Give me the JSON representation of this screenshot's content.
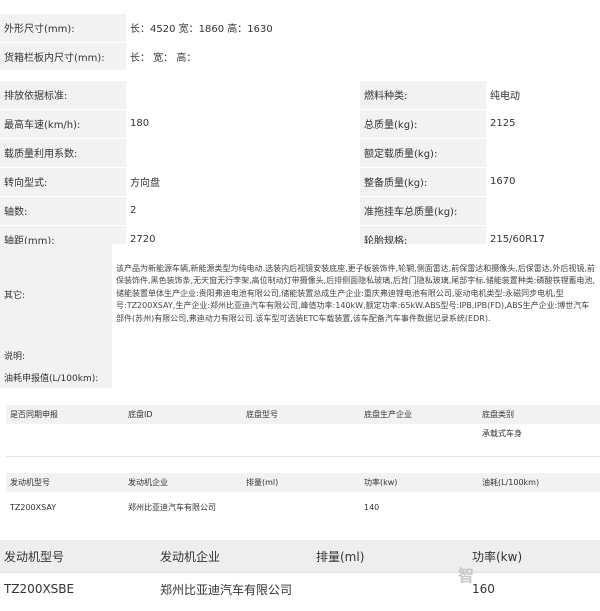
{
  "specs": {
    "dims_label": "外形尺寸(mm):",
    "dims_value": "长：4520 宽：1860 高：1630",
    "cargo_label": "货箱栏板内尺寸(mm):",
    "cargo_value": "长： 宽： 高：",
    "emission_label": "排放依据标准:",
    "fuel_label": "燃料种类:",
    "fuel_value": "纯电动",
    "speed_label": "最高车速(km/h):",
    "speed_value": "180",
    "total_mass_label": "总质量(kg):",
    "total_mass_value": "2125",
    "load_util_label": "载质量利用系数:",
    "rated_load_label": "额定载质量(kg):",
    "steering_label": "转向型式:",
    "steering_value": "方向盘",
    "curb_mass_label": "整备质量(kg):",
    "curb_mass_value": "1670",
    "axles_label": "轴数:",
    "axles_value": "2",
    "trailer_label": "准拖挂车总质量(kg):",
    "wheelbase_label": "轴距(mm):",
    "wheelbase_value": "2720",
    "tire_label": "轮胎规格:",
    "tire_value": "215/60R17"
  },
  "other": {
    "label": "其它:",
    "text": "该产品为新能源车辆,新能源类型为纯电动.选装内后视镜安装底座,更子板装饰件,轮辋,侧面雷达,前保雷达和摄像头,后保雷达,外后视镜,前保装饰件,黑色装饰条,无天窗无行李架,高位制动灯带摄像头,后排侧面隐私玻璃,后背门隐私玻璃,尾部字标.储能装置种类:磷酸铁锂蓄电池,储能装置单体生产企业:贵阳弗迪电池有限公司,储能装置总成生产企业:重庆弗迪锂电池有限公司,驱动电机类型:永磁同步电机,型号:TZ200XSAY,生产企业:郑州比亚迪汽车有限公司,峰值功率:140kW,额定功率:65kW.ABS型号:IPB,IPB(FD),ABS生产企业:博世汽车部件(苏州)有限公司,弗迪动力有限公司.该车型可选装ETC车载装置,该车配备汽车事件数据记录系统(EDR).",
    "note_label": "说明:",
    "fuel_consumption_label": "油耗申报值(L/100km):"
  },
  "chassis": {
    "headers": [
      "是否同期申报",
      "底盘ID",
      "底盘型号",
      "底盘生产企业",
      "底盘类别"
    ],
    "row": [
      "",
      "",
      "",
      "",
      "承载式车身"
    ]
  },
  "engine_small": {
    "headers": [
      "发动机型号",
      "发动机企业",
      "排量(ml)",
      "功率(kw)",
      "油耗(L/100km)"
    ],
    "row": [
      "TZ200XSAY",
      "郑州比亚迪汽车有限公司",
      "",
      "140",
      ""
    ]
  },
  "engine_large": {
    "headers": [
      "发动机型号",
      "发动机企业",
      "排量(ml)",
      "功率(kw)"
    ],
    "row": [
      "TZ200XSBE",
      "郑州比亚迪汽车有限公司",
      "",
      "160"
    ]
  },
  "watermark": "智"
}
